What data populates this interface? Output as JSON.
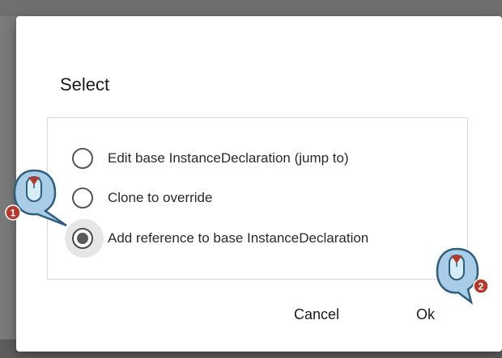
{
  "dialog": {
    "title": "Select",
    "options": [
      {
        "label": "Edit base InstanceDeclaration (jump to)",
        "checked": false
      },
      {
        "label": "Clone to override",
        "checked": false
      },
      {
        "label": "Add reference to base InstanceDeclaration",
        "checked": true
      }
    ],
    "cancel_label": "Cancel",
    "ok_label": "Ok"
  },
  "annotations": [
    {
      "step": "1",
      "icon": "mouse-click-callout-icon"
    },
    {
      "step": "2",
      "icon": "mouse-click-callout-icon"
    }
  ],
  "colors": {
    "accent_marker": "#b23a2e",
    "callout_fill": "#a9cde6",
    "callout_stroke": "#2f5d7c"
  }
}
